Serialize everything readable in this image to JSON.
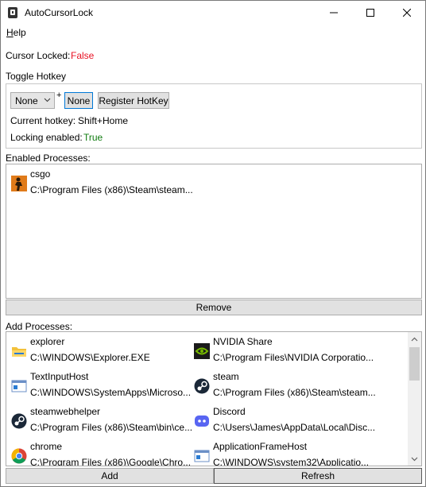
{
  "window": {
    "title": "AutoCursorLock",
    "controls": [
      "minimize-icon",
      "maximize-icon",
      "close-icon"
    ]
  },
  "menu": {
    "help_first": "H",
    "help_rest": "elp"
  },
  "status": {
    "cursor_locked_label": "Cursor Locked:",
    "cursor_locked_value": "False",
    "cursor_locked_color": "#e81123"
  },
  "hotkey": {
    "section_label": "Toggle Hotkey",
    "modifier_value": "None",
    "plus": "+",
    "key_button": "None",
    "register_button": "Register HotKey",
    "current_label": "Current hotkey:",
    "current_value": "Shift+Home",
    "locking_label": "Locking enabled:",
    "locking_value": "True",
    "locking_color": "#107c10"
  },
  "enabled": {
    "section_label": "Enabled Processes:",
    "items": [
      {
        "name": "csgo",
        "path": "C:\\Program Files (x86)\\Steam\\steam...",
        "icon": "csgo-icon"
      }
    ],
    "remove_button": "Remove"
  },
  "add": {
    "section_label": "Add Processes:",
    "items": [
      {
        "name": "explorer",
        "path": "C:\\WINDOWS\\Explorer.EXE",
        "icon": "folder-icon"
      },
      {
        "name": "NVIDIA Share",
        "path": "C:\\Program Files\\NVIDIA Corporatio...",
        "icon": "nvidia-icon"
      },
      {
        "name": "TextInputHost",
        "path": "C:\\WINDOWS\\SystemApps\\Microso...",
        "icon": "app-window-icon"
      },
      {
        "name": "steam",
        "path": "C:\\Program Files (x86)\\Steam\\steam...",
        "icon": "steam-icon"
      },
      {
        "name": "steamwebhelper",
        "path": "C:\\Program Files (x86)\\Steam\\bin\\ce...",
        "icon": "steam-icon"
      },
      {
        "name": "Discord",
        "path": "C:\\Users\\James\\AppData\\Local\\Disc...",
        "icon": "discord-icon"
      },
      {
        "name": "chrome",
        "path": "C:\\Program Files (x86)\\Google\\Chro...",
        "icon": "chrome-icon"
      },
      {
        "name": "ApplicationFrameHost",
        "path": "C:\\WINDOWS\\system32\\Applicatio...",
        "icon": "app-window-icon"
      }
    ],
    "add_button": "Add",
    "refresh_button": "Refresh"
  }
}
